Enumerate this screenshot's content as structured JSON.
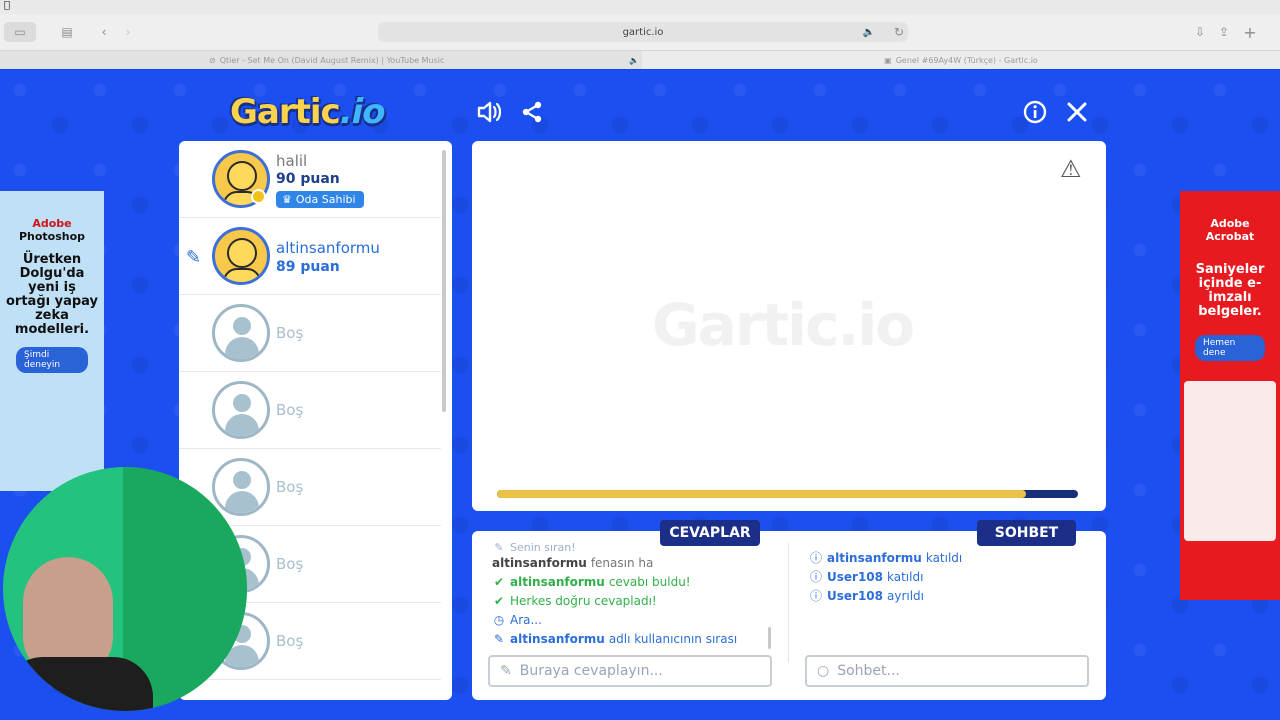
{
  "browser": {
    "url": "gartic.io",
    "tabs": [
      {
        "title": "Qtier - Set Me On (David August Remix) | YouTube Music"
      },
      {
        "title": "Genel #69Ay4W (Türkçe) - Gartic.io"
      }
    ]
  },
  "game": {
    "logo_main": "Gartic",
    "logo_io": ".io",
    "players": [
      {
        "name": "halil",
        "points": "90 puan",
        "badge": "Oda Sahibi"
      },
      {
        "name": "altinsanformu",
        "points": "89 puan"
      },
      {
        "name": "Boş"
      },
      {
        "name": "Boş"
      },
      {
        "name": "Boş"
      },
      {
        "name": "Boş"
      },
      {
        "name": "Boş"
      }
    ],
    "canvas": {
      "watermark": "Gartic.io",
      "timer_fraction": 0.91
    },
    "answers_tab": "CEVAPLAR",
    "chat_tab": "SOHBET",
    "answers": {
      "faded_line": "Senin sıran!",
      "lines": [
        {
          "user": "altinsanformu",
          "text": "fenasın ha"
        },
        {
          "user": "altinsanformu",
          "text": "cevabı buldu!"
        },
        {
          "text": "Herkes doğru cevapladı!"
        },
        {
          "text": "Ara..."
        },
        {
          "user": "altinsanformu",
          "text": "adlı kullanıcının sırası"
        }
      ],
      "input_placeholder": "Buraya cevaplayın..."
    },
    "chat": {
      "lines": [
        {
          "user": "altinsanformu",
          "text": "katıldı"
        },
        {
          "user": "User108",
          "text": "katıldı"
        },
        {
          "user": "User108",
          "text": "ayrıldı"
        }
      ],
      "input_placeholder": "Sohbet..."
    }
  },
  "ads": {
    "left": {
      "brand_1": "Adobe",
      "brand_2": "Photoshop",
      "text": "Üretken Dolgu'da yeni iş ortağı yapay zeka modelleri.",
      "cta": "Şimdi deneyin"
    },
    "right": {
      "brand_1": "Adobe",
      "brand_2": "Acrobat",
      "text": "Saniyeler içinde e-imzalı belgeler.",
      "cta": "Hemen dene"
    }
  },
  "colors": {
    "page_bg": "#1c4ff0",
    "accent_dark": "#1c2f88",
    "timer": "#e9c24a",
    "success": "#31b04a",
    "info": "#2b6ed9"
  }
}
